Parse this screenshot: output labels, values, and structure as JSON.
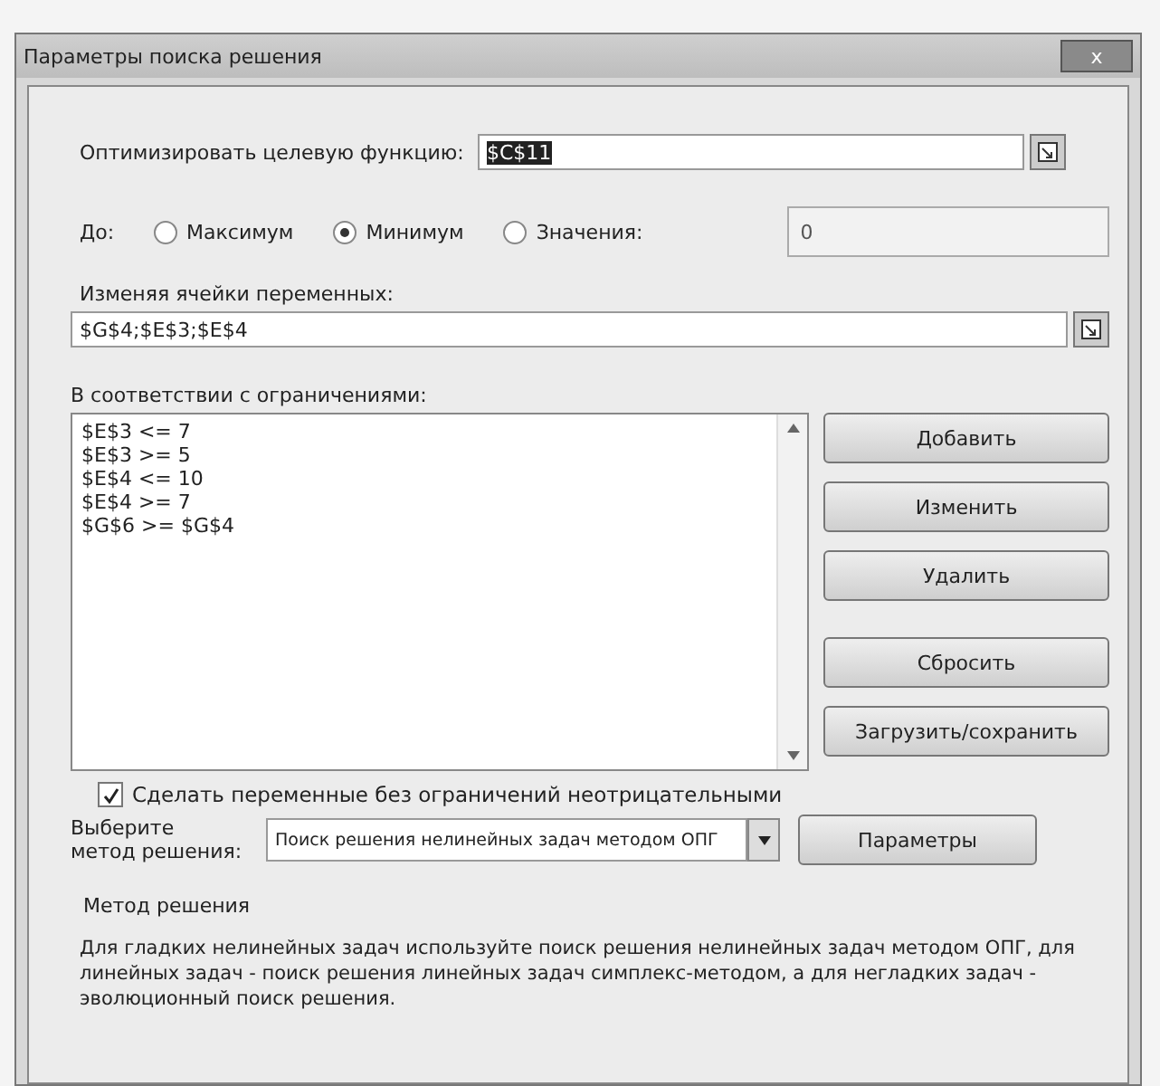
{
  "window": {
    "title": "Параметры поиска решения",
    "close": "x"
  },
  "objective": {
    "label": "Оптимизировать целевую функцию:",
    "value": "$C$11",
    "selected": true
  },
  "to": {
    "label": "До:",
    "options": [
      {
        "label": "Максимум",
        "selected": false
      },
      {
        "label": "Минимум",
        "selected": true
      },
      {
        "label": "Значения:",
        "selected": false
      }
    ],
    "value": "0"
  },
  "variables": {
    "label": "Изменяя ячейки переменных:",
    "value": "$G$4;$E$3;$E$4"
  },
  "constraints": {
    "label": "В соответствии с ограничениями:",
    "items": [
      "$E$3 <= 7",
      "$E$3 >= 5",
      "$E$4 <= 10",
      "$E$4 >= 7",
      "$G$6 >= $G$4"
    ]
  },
  "buttons": [
    "Добавить",
    "Изменить",
    "Удалить",
    "Сбросить",
    "Загрузить/сохранить"
  ],
  "nonnegative": {
    "label": "Сделать переменные без ограничений неотрицательными",
    "checked": true
  },
  "method": {
    "label": "Выберите\nметод решения:",
    "value": "Поиск решения нелинейных задач методом ОПГ",
    "button": "Параметры"
  },
  "method_info": {
    "title": "Метод решения",
    "text": "Для гладких нелинейных задач используйте поиск решения нелинейных задач методом ОПГ, для линейных задач - поиск решения линейных задач симплекс-методом, а для негладких задач - эволюционный поиск решения."
  }
}
